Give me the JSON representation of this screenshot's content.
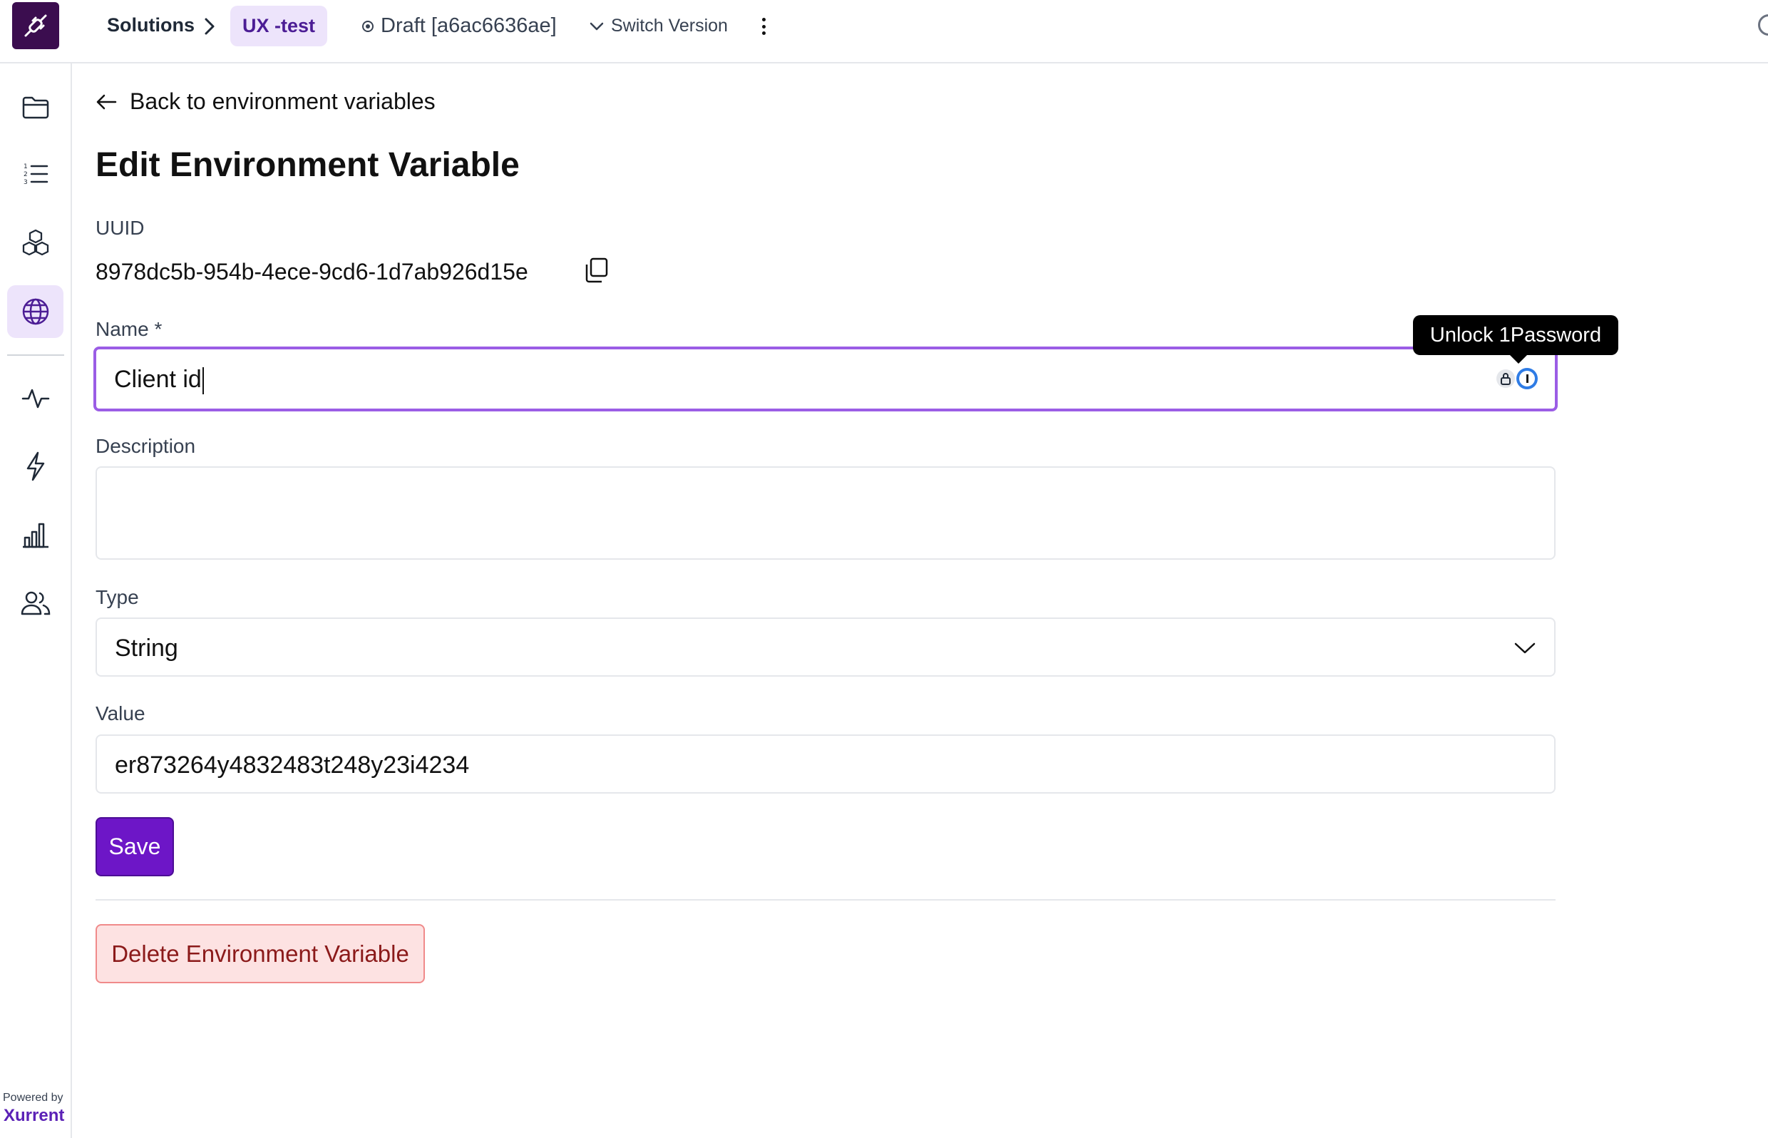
{
  "topbar": {
    "breadcrumb_root": "Solutions",
    "breadcrumb_current": "UX -test",
    "draft_label": "Draft [a6ac6636ae]",
    "switch_version_label": "Switch Version"
  },
  "sidebar": {
    "items": [
      {
        "icon": "folder-icon",
        "active": false
      },
      {
        "icon": "numbered-list-icon",
        "active": false
      },
      {
        "icon": "cubes-icon",
        "active": false
      },
      {
        "icon": "globe-icon",
        "active": true
      },
      {
        "icon": "activity-icon",
        "active": false
      },
      {
        "icon": "lightning-icon",
        "active": false
      },
      {
        "icon": "bar-chart-icon",
        "active": false
      },
      {
        "icon": "users-icon",
        "active": false
      }
    ],
    "powered_by": "Powered by",
    "brand": "Xurrent"
  },
  "main": {
    "back_link": "Back to environment variables",
    "title": "Edit Environment Variable",
    "uuid_label": "UUID",
    "uuid_value": "8978dc5b-954b-4ece-9cd6-1d7ab926d15e",
    "name_label": "Name *",
    "name_value": "Client id",
    "description_label": "Description",
    "description_value": "",
    "type_label": "Type",
    "type_value": "String",
    "value_label": "Value",
    "value_value": "er873264y4832483t248y23i4234",
    "save_label": "Save",
    "delete_label": "Delete Environment Variable",
    "tooltip": "Unlock 1Password"
  },
  "colors": {
    "accent": "#6d16c7",
    "focus_border": "#9b5de5",
    "active_bg": "#ede4fb",
    "danger_bg": "#fde2e2",
    "danger_text": "#8b1a1a"
  }
}
